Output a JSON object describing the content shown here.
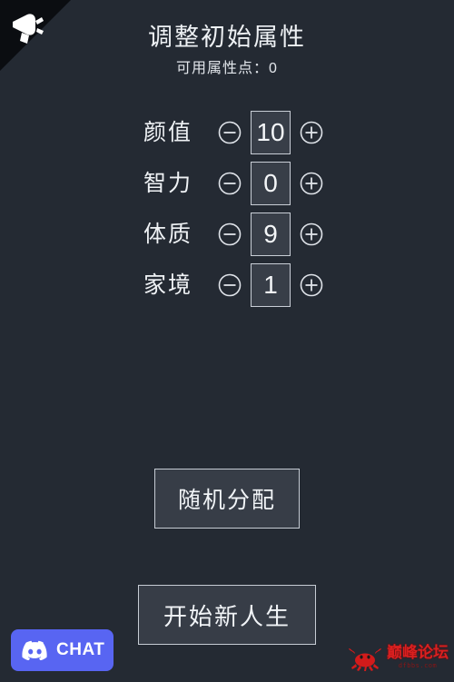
{
  "theme": {
    "background": "#242a33",
    "corner_wedge": "#0b0d11",
    "panel_fill": "#383e48",
    "border": "#c9ced6",
    "text": "#eef1f4",
    "discord_blurple": "#5865f2",
    "watermark_red": "#e02020"
  },
  "header": {
    "title": "调整初始属性",
    "points_line": "可用属性点：0",
    "available_points": 0
  },
  "corner": {
    "icon": "megaphone-icon"
  },
  "attributes": [
    {
      "label": "颜值",
      "value": "10",
      "decrease_icon": "minus-circle-icon",
      "increase_icon": "plus-circle-icon"
    },
    {
      "label": "智力",
      "value": "0",
      "decrease_icon": "minus-circle-icon",
      "increase_icon": "plus-circle-icon"
    },
    {
      "label": "体质",
      "value": "9",
      "decrease_icon": "minus-circle-icon",
      "increase_icon": "plus-circle-icon"
    },
    {
      "label": "家境",
      "value": "1",
      "decrease_icon": "minus-circle-icon",
      "increase_icon": "plus-circle-icon"
    }
  ],
  "actions": {
    "random_assign_label": "随机分配",
    "start_life_label": "开始新人生"
  },
  "chat_widget": {
    "label": "CHAT",
    "icon": "discord-icon"
  },
  "watermark": {
    "icon": "crab-icon",
    "title": "巅峰论坛",
    "subtitle": "dfbbs.com"
  }
}
